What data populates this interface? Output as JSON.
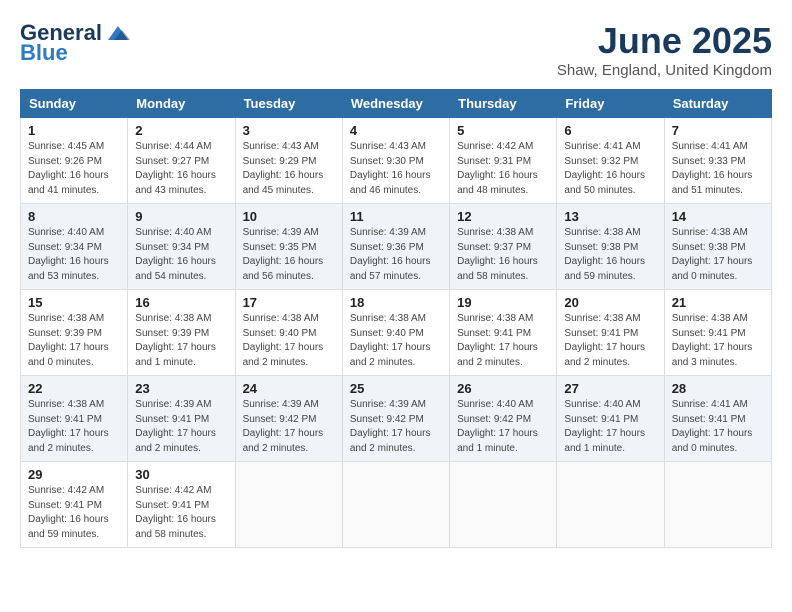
{
  "header": {
    "logo_line1": "General",
    "logo_line2": "Blue",
    "title": "June 2025",
    "subtitle": "Shaw, England, United Kingdom"
  },
  "days_of_week": [
    "Sunday",
    "Monday",
    "Tuesday",
    "Wednesday",
    "Thursday",
    "Friday",
    "Saturday"
  ],
  "weeks": [
    {
      "shade": false,
      "days": [
        {
          "num": "1",
          "info": "Sunrise: 4:45 AM\nSunset: 9:26 PM\nDaylight: 16 hours\nand 41 minutes."
        },
        {
          "num": "2",
          "info": "Sunrise: 4:44 AM\nSunset: 9:27 PM\nDaylight: 16 hours\nand 43 minutes."
        },
        {
          "num": "3",
          "info": "Sunrise: 4:43 AM\nSunset: 9:29 PM\nDaylight: 16 hours\nand 45 minutes."
        },
        {
          "num": "4",
          "info": "Sunrise: 4:43 AM\nSunset: 9:30 PM\nDaylight: 16 hours\nand 46 minutes."
        },
        {
          "num": "5",
          "info": "Sunrise: 4:42 AM\nSunset: 9:31 PM\nDaylight: 16 hours\nand 48 minutes."
        },
        {
          "num": "6",
          "info": "Sunrise: 4:41 AM\nSunset: 9:32 PM\nDaylight: 16 hours\nand 50 minutes."
        },
        {
          "num": "7",
          "info": "Sunrise: 4:41 AM\nSunset: 9:33 PM\nDaylight: 16 hours\nand 51 minutes."
        }
      ]
    },
    {
      "shade": true,
      "days": [
        {
          "num": "8",
          "info": "Sunrise: 4:40 AM\nSunset: 9:34 PM\nDaylight: 16 hours\nand 53 minutes."
        },
        {
          "num": "9",
          "info": "Sunrise: 4:40 AM\nSunset: 9:34 PM\nDaylight: 16 hours\nand 54 minutes."
        },
        {
          "num": "10",
          "info": "Sunrise: 4:39 AM\nSunset: 9:35 PM\nDaylight: 16 hours\nand 56 minutes."
        },
        {
          "num": "11",
          "info": "Sunrise: 4:39 AM\nSunset: 9:36 PM\nDaylight: 16 hours\nand 57 minutes."
        },
        {
          "num": "12",
          "info": "Sunrise: 4:38 AM\nSunset: 9:37 PM\nDaylight: 16 hours\nand 58 minutes."
        },
        {
          "num": "13",
          "info": "Sunrise: 4:38 AM\nSunset: 9:38 PM\nDaylight: 16 hours\nand 59 minutes."
        },
        {
          "num": "14",
          "info": "Sunrise: 4:38 AM\nSunset: 9:38 PM\nDaylight: 17 hours\nand 0 minutes."
        }
      ]
    },
    {
      "shade": false,
      "days": [
        {
          "num": "15",
          "info": "Sunrise: 4:38 AM\nSunset: 9:39 PM\nDaylight: 17 hours\nand 0 minutes."
        },
        {
          "num": "16",
          "info": "Sunrise: 4:38 AM\nSunset: 9:39 PM\nDaylight: 17 hours\nand 1 minute."
        },
        {
          "num": "17",
          "info": "Sunrise: 4:38 AM\nSunset: 9:40 PM\nDaylight: 17 hours\nand 2 minutes."
        },
        {
          "num": "18",
          "info": "Sunrise: 4:38 AM\nSunset: 9:40 PM\nDaylight: 17 hours\nand 2 minutes."
        },
        {
          "num": "19",
          "info": "Sunrise: 4:38 AM\nSunset: 9:41 PM\nDaylight: 17 hours\nand 2 minutes."
        },
        {
          "num": "20",
          "info": "Sunrise: 4:38 AM\nSunset: 9:41 PM\nDaylight: 17 hours\nand 2 minutes."
        },
        {
          "num": "21",
          "info": "Sunrise: 4:38 AM\nSunset: 9:41 PM\nDaylight: 17 hours\nand 3 minutes."
        }
      ]
    },
    {
      "shade": true,
      "days": [
        {
          "num": "22",
          "info": "Sunrise: 4:38 AM\nSunset: 9:41 PM\nDaylight: 17 hours\nand 2 minutes."
        },
        {
          "num": "23",
          "info": "Sunrise: 4:39 AM\nSunset: 9:41 PM\nDaylight: 17 hours\nand 2 minutes."
        },
        {
          "num": "24",
          "info": "Sunrise: 4:39 AM\nSunset: 9:42 PM\nDaylight: 17 hours\nand 2 minutes."
        },
        {
          "num": "25",
          "info": "Sunrise: 4:39 AM\nSunset: 9:42 PM\nDaylight: 17 hours\nand 2 minutes."
        },
        {
          "num": "26",
          "info": "Sunrise: 4:40 AM\nSunset: 9:42 PM\nDaylight: 17 hours\nand 1 minute."
        },
        {
          "num": "27",
          "info": "Sunrise: 4:40 AM\nSunset: 9:41 PM\nDaylight: 17 hours\nand 1 minute."
        },
        {
          "num": "28",
          "info": "Sunrise: 4:41 AM\nSunset: 9:41 PM\nDaylight: 17 hours\nand 0 minutes."
        }
      ]
    },
    {
      "shade": false,
      "days": [
        {
          "num": "29",
          "info": "Sunrise: 4:42 AM\nSunset: 9:41 PM\nDaylight: 16 hours\nand 59 minutes."
        },
        {
          "num": "30",
          "info": "Sunrise: 4:42 AM\nSunset: 9:41 PM\nDaylight: 16 hours\nand 58 minutes."
        },
        {
          "num": "",
          "info": ""
        },
        {
          "num": "",
          "info": ""
        },
        {
          "num": "",
          "info": ""
        },
        {
          "num": "",
          "info": ""
        },
        {
          "num": "",
          "info": ""
        }
      ]
    }
  ]
}
